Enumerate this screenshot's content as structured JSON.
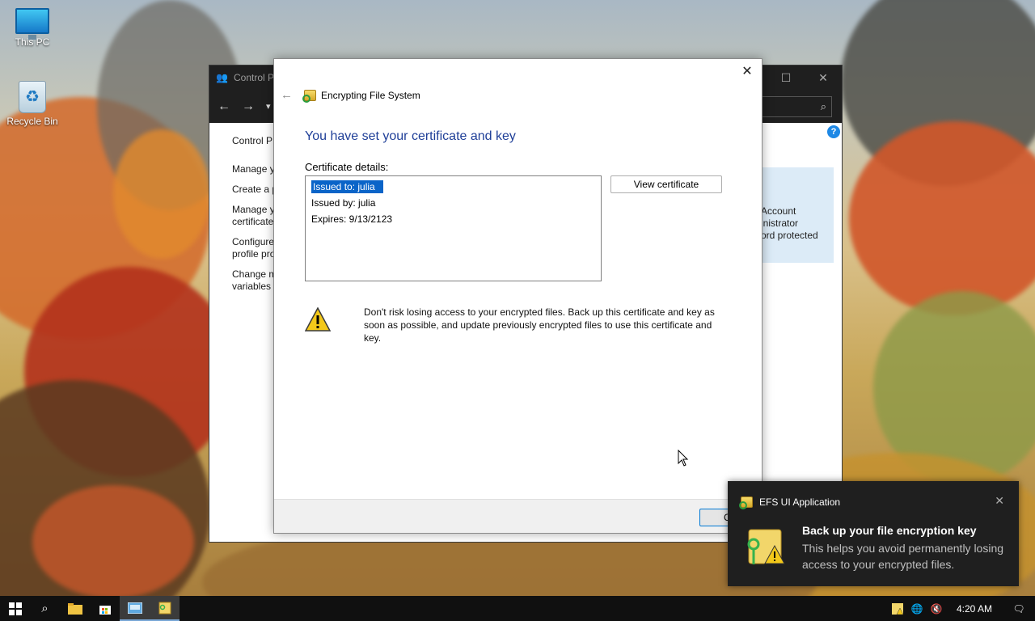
{
  "desktop": {
    "icons": [
      {
        "label": "This PC"
      },
      {
        "label": "Recycle Bin"
      }
    ]
  },
  "control_panel": {
    "title": "Control P",
    "sidebar": [
      "Control P",
      "Manage y",
      "Create a p",
      "Manage y certificate",
      "Configure profile pro",
      "Change m variables"
    ],
    "account_panel": [
      "Account",
      "inistrator",
      "ord protected"
    ]
  },
  "efs_dialog": {
    "title": "Encrypting File System",
    "heading": "You have set your certificate and key",
    "cert_label": "Certificate details:",
    "cert_lines": [
      "Issued to: julia",
      "Issued by: julia",
      "Expires: 9/13/2123"
    ],
    "view_cert_label": "View certificate",
    "warning": "Don't risk losing access to your encrypted files. Back up this certificate and key as soon as possible, and update previously encrypted files to use this certificate and key.",
    "close_label": "Clo"
  },
  "toast": {
    "app_name": "EFS UI Application",
    "title": "Back up your file encryption key",
    "body": "This helps you avoid permanently losing access to your encrypted files."
  },
  "taskbar": {
    "time": "4:20 AM"
  },
  "colors": {
    "heading_blue": "#1f3f98",
    "selection_blue": "#0a64c8",
    "taskbar_bg": "#101010"
  }
}
